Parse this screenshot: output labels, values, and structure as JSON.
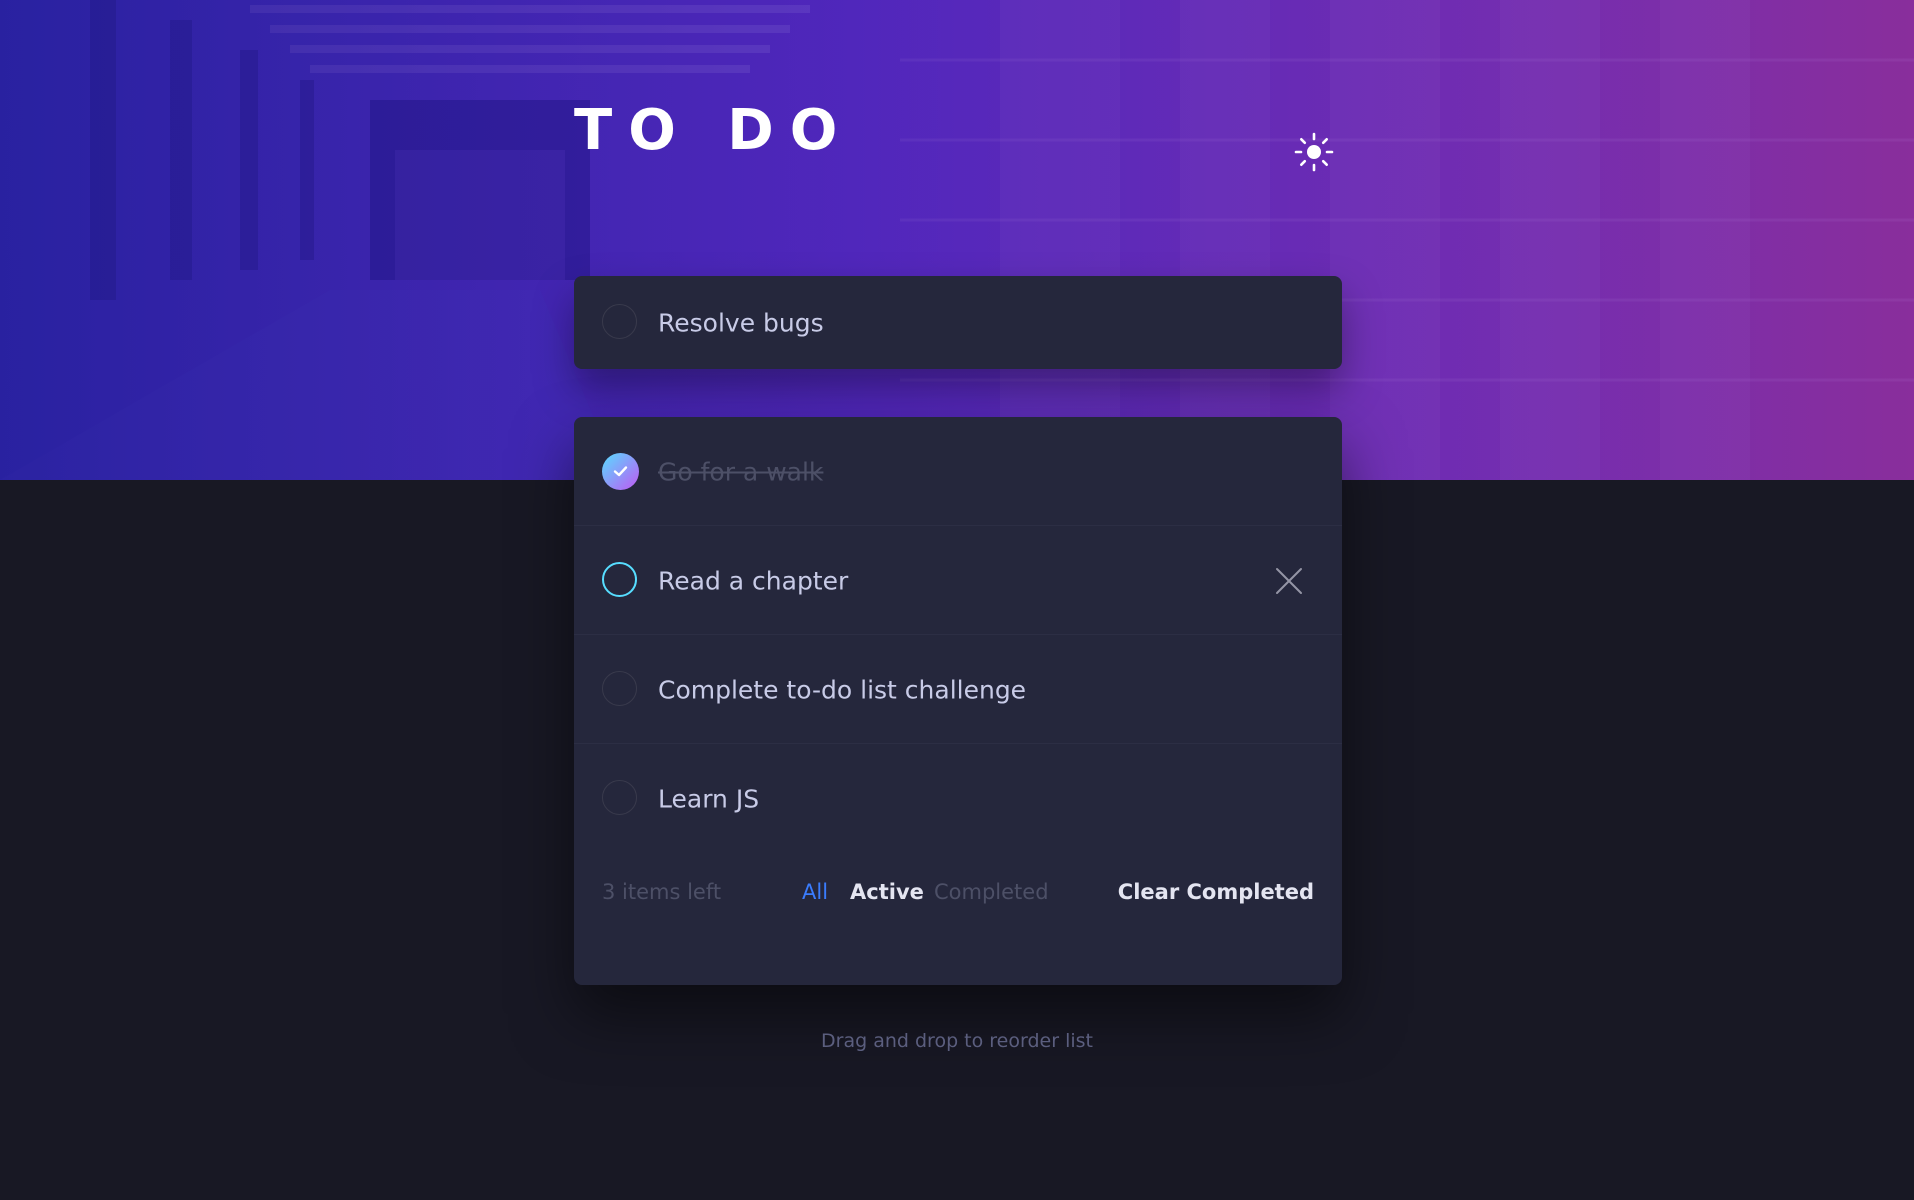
{
  "header": {
    "title": "TO DO",
    "theme_icon": "sun-icon"
  },
  "new_todo": {
    "value": "Resolve bugs"
  },
  "todos": [
    {
      "text": "Go for a walk",
      "completed": true
    },
    {
      "text": "Read a chapter",
      "completed": false
    },
    {
      "text": "Complete to-do list challenge",
      "completed": false
    },
    {
      "text": "Learn JS",
      "completed": false
    }
  ],
  "footer": {
    "items_left": "3 items left",
    "filter_all": "All",
    "filter_active": "Active",
    "filter_completed": "Completed",
    "clear_completed": "Clear Completed"
  },
  "hint": "Drag and drop to reorder list",
  "colors": {
    "background": "#181824",
    "card": "#25273c",
    "accent": "#3a7cfd",
    "check_gradient_start": "#57ddff",
    "check_gradient_end": "#c058f3"
  }
}
